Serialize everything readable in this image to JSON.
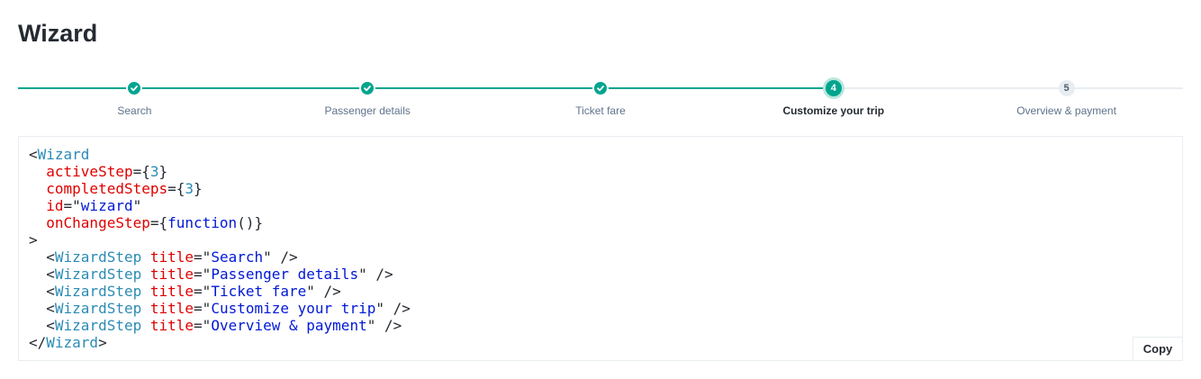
{
  "page": {
    "title": "Wizard"
  },
  "wizard": {
    "active_step": 4,
    "steps": [
      {
        "label": "Search",
        "number": "1",
        "status": "completed"
      },
      {
        "label": "Passenger details",
        "number": "2",
        "status": "completed"
      },
      {
        "label": "Ticket fare",
        "number": "3",
        "status": "completed"
      },
      {
        "label": "Customize your trip",
        "number": "4",
        "status": "active"
      },
      {
        "label": "Overview & payment",
        "number": "5",
        "status": "upcoming"
      }
    ]
  },
  "code": {
    "component": "Wizard",
    "step_component": "WizardStep",
    "prop_active_step": "activeStep",
    "active_step_value": "3",
    "prop_completed_steps": "completedSteps",
    "completed_steps_value": "3",
    "prop_id": "id",
    "id_value": "wizard",
    "prop_on_change": "onChangeStep",
    "on_change_value": "function",
    "prop_title": "title",
    "step_titles": [
      "Search",
      "Passenger details",
      "Ticket fare",
      "Customize your trip",
      "Overview & payment"
    ],
    "copy_label": "Copy"
  },
  "colors": {
    "accent": "#00a58e",
    "accent_halo": "#b8e6dd",
    "inactive": "#e8edf1",
    "text": "#252a31",
    "muted": "#5f738c"
  },
  "icons": {
    "completed_step": "check-icon"
  }
}
